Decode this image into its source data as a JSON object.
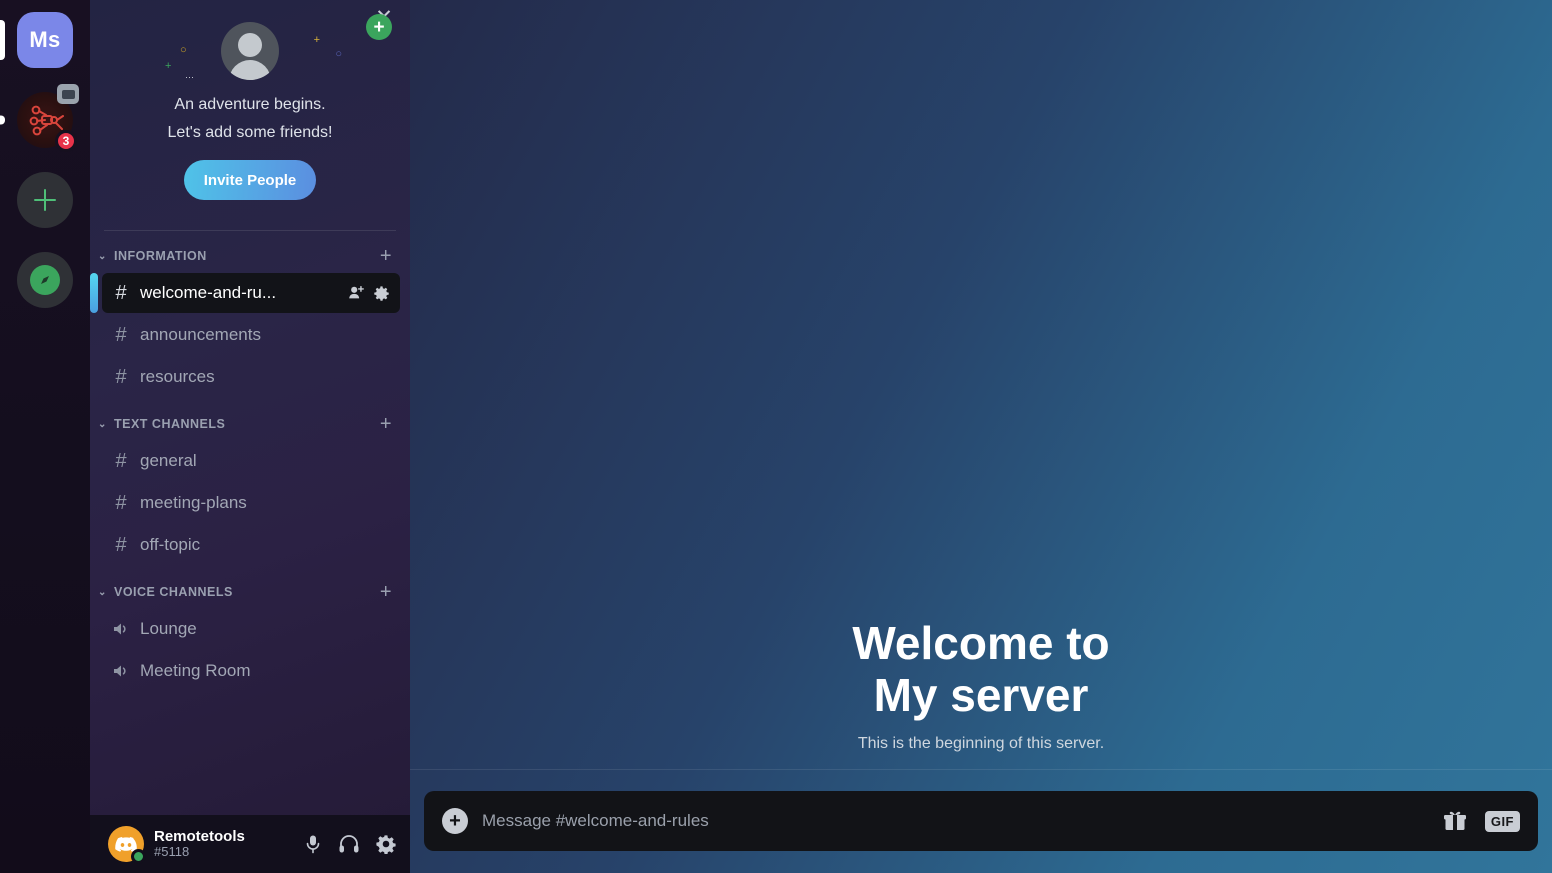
{
  "rail": {
    "servers": [
      {
        "name": "Ms",
        "type": "tile",
        "active": true
      },
      {
        "name": "network-server",
        "type": "image",
        "badge": "3",
        "screen_share": true
      }
    ],
    "add_label": "+",
    "explore_label": "Compass"
  },
  "banner": {
    "close_label": "✕",
    "line1": "An adventure begins.",
    "line2": "Let's add some friends!",
    "invite_label": "Invite People",
    "plus_label": "+"
  },
  "sidebar": {
    "categories": [
      {
        "label": "INFORMATION",
        "add_label": "+",
        "chevron": "⌄",
        "channels": [
          {
            "name": "welcome-and-ru...",
            "type": "text",
            "active": true
          },
          {
            "name": "announcements",
            "type": "text",
            "active": false
          },
          {
            "name": "resources",
            "type": "text",
            "active": false
          }
        ]
      },
      {
        "label": "TEXT CHANNELS",
        "add_label": "+",
        "chevron": "⌄",
        "channels": [
          {
            "name": "general",
            "type": "text",
            "active": false
          },
          {
            "name": "meeting-plans",
            "type": "text",
            "active": false
          },
          {
            "name": "off-topic",
            "type": "text",
            "active": false
          }
        ]
      },
      {
        "label": "VOICE CHANNELS",
        "add_label": "+",
        "chevron": "⌄",
        "channels": [
          {
            "name": "Lounge",
            "type": "voice",
            "active": false
          },
          {
            "name": "Meeting Room",
            "type": "voice",
            "active": false
          }
        ]
      }
    ]
  },
  "user": {
    "name": "Remotetools",
    "tag": "#5118",
    "status": "online"
  },
  "main": {
    "welcome_line1": "Welcome to",
    "welcome_line2": "My server",
    "subtitle": "This is the beginning of this server.",
    "composer_placeholder": "Message #welcome-and-rules",
    "attach_label": "+",
    "gif_label": "GIF"
  },
  "colors": {
    "accent": "#5b8ee0",
    "badge": "#e8334a",
    "online": "#3ba55d",
    "server_tile": "#7b87e8"
  }
}
